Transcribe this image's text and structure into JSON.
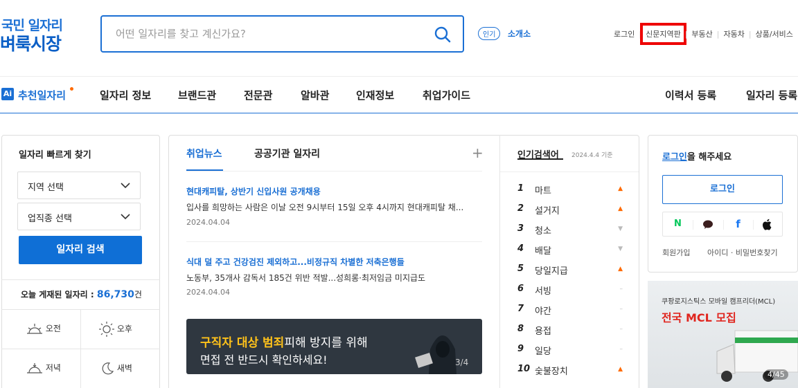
{
  "header": {
    "logo_line1": "국민 일자리",
    "logo_line2": "벼룩시장",
    "search_placeholder": "어떤 일자리를 찾고 계신가요?",
    "popular_badge": "인기",
    "popular_keyword": "소개소",
    "top_links": [
      "로그인",
      "신문지역판",
      "부동산",
      "자동차",
      "상품/서비스"
    ]
  },
  "nav": {
    "ai_badge": "Ai",
    "recommend": "추천일자리",
    "items": [
      "일자리 정보",
      "브랜드관",
      "전문관",
      "알바관",
      "인재정보",
      "취업가이드"
    ],
    "right_items": [
      "이력서 등록",
      "일자리 등록"
    ]
  },
  "quick_search": {
    "title": "일자리 빠르게 찾기",
    "region_select": "지역 선택",
    "category_select": "업직종 선택",
    "search_button": "일자리 검색",
    "posted_label": "오늘 게재된 일자리 :",
    "posted_count": "86,730",
    "posted_unit": "건",
    "times": [
      "오전",
      "오후",
      "저녁",
      "새벽"
    ]
  },
  "news": {
    "tabs": [
      "취업뉴스",
      "공공기관 일자리"
    ],
    "articles": [
      {
        "title": "현대캐피탈, 상반기 신입사원 공개채용",
        "desc": "입사를 희망하는 사람은 이날 오전 9시부터 15일 오후 4시까지 현대캐피탈 채...",
        "date": "2024.04.04"
      },
      {
        "title": "식대 덜 주고 건강검진 제외하고...비정규직 차별한 저축은행들",
        "desc": "노동부, 35개사 감독서 185건 위반 적발...성희롱·최저임금 미지급도",
        "date": "2024.04.04"
      }
    ],
    "banner_highlight": "구직자 대상 범죄",
    "banner_line1_rest": "피해 방지를 위해",
    "banner_line2": "면접 전 반드시 확인하세요!",
    "banner_page": "3/4"
  },
  "ranking": {
    "title": "인기검색어",
    "date": "2024.4.4 기준",
    "items": [
      {
        "rank": "1",
        "keyword": "마트",
        "trend": "up"
      },
      {
        "rank": "2",
        "keyword": "설거지",
        "trend": "up"
      },
      {
        "rank": "3",
        "keyword": "청소",
        "trend": "down"
      },
      {
        "rank": "4",
        "keyword": "배달",
        "trend": "down"
      },
      {
        "rank": "5",
        "keyword": "당일지급",
        "trend": "up"
      },
      {
        "rank": "6",
        "keyword": "서빙",
        "trend": "same"
      },
      {
        "rank": "7",
        "keyword": "야간",
        "trend": "same"
      },
      {
        "rank": "8",
        "keyword": "용접",
        "trend": "same"
      },
      {
        "rank": "9",
        "keyword": "일당",
        "trend": "same"
      },
      {
        "rank": "10",
        "keyword": "숯불장치",
        "trend": "up"
      }
    ]
  },
  "login_box": {
    "prompt_link": "로그인",
    "prompt_rest": "을 해주세요",
    "login_button": "로그인",
    "social": [
      "N",
      "talk",
      "f",
      "apple"
    ],
    "signup": "회원가입",
    "find": "아이디 · 비밀번호찾기"
  },
  "ad": {
    "company": "쿠팡로지스틱스 모바일 캠프리더(MCL)",
    "headline": "전국 MCL 모집",
    "page": "4/45"
  },
  "colors": {
    "brand": "#1a6fd4",
    "accent": "#ff6a00",
    "highlight": "#e00000"
  }
}
